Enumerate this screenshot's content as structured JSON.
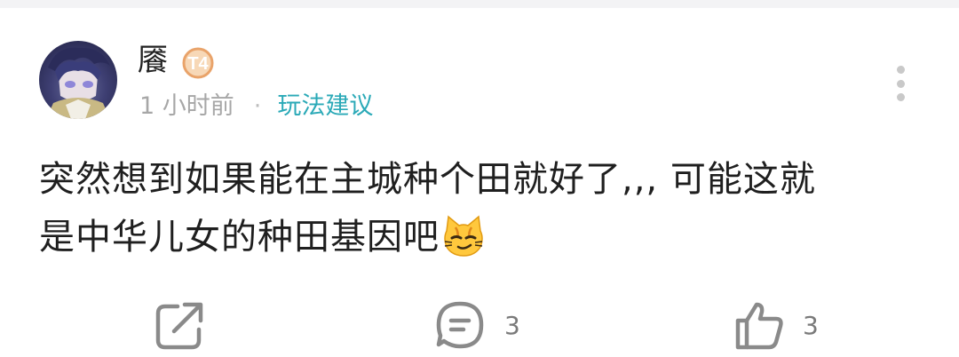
{
  "comment": {
    "user": {
      "name": "餍",
      "level_badge": "T4"
    },
    "time": "1 小时前",
    "separator": "·",
    "category": "玩法建议",
    "text_line1": "突然想到如果能在主城种个田就好了,,, 可能这就",
    "text_line2": "是中华儿女的种田基因吧",
    "emoji": "smirking-cat-emoji"
  },
  "actions": {
    "share_icon": "share-icon",
    "comment_icon": "comment-bubble-icon",
    "comment_count": "3",
    "like_icon": "thumbs-up-icon",
    "like_count": "3"
  },
  "colors": {
    "accent": "#2aa9b7",
    "badge": "#e9a36a",
    "muted": "#a7a7a7"
  }
}
